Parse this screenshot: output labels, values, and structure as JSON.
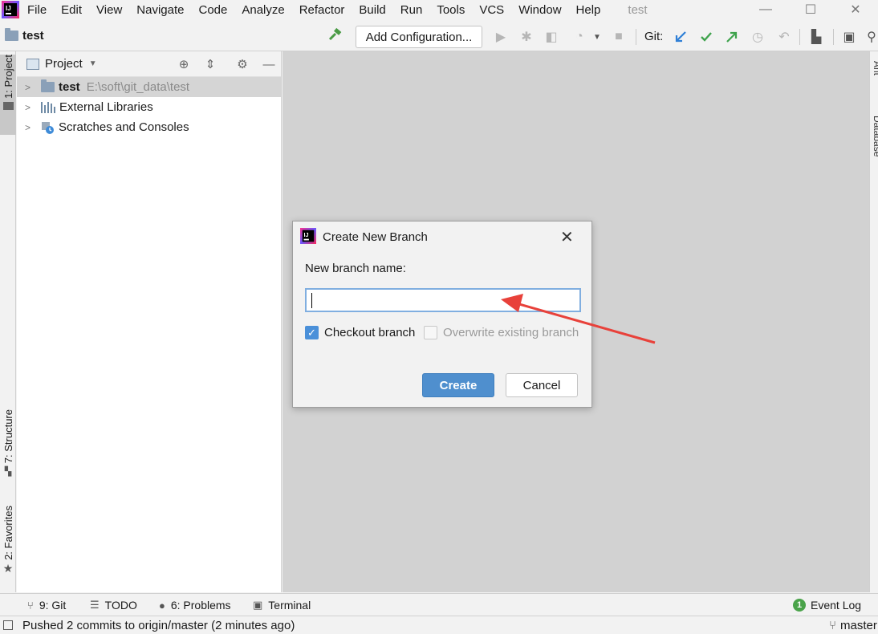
{
  "menu": {
    "items": [
      "File",
      "Edit",
      "View",
      "Navigate",
      "Code",
      "Analyze",
      "Refactor",
      "Build",
      "Run",
      "Tools",
      "VCS",
      "Window",
      "Help"
    ],
    "window_title": "test"
  },
  "navbar": {
    "project_name": "test",
    "add_configuration": "Add Configuration...",
    "git_label": "Git:"
  },
  "left_stripe": {
    "project_tab": "1: Project",
    "structure_tab": "7: Structure",
    "favorites_tab": "2: Favorites"
  },
  "right_stripe": {
    "ant_tab": "Ant",
    "database_tab": "Database"
  },
  "project_panel": {
    "title": "Project",
    "tree": [
      {
        "label": "test",
        "path": "E:\\soft\\git_data\\test"
      },
      {
        "label": "External Libraries",
        "path": ""
      },
      {
        "label": "Scratches and Consoles",
        "path": ""
      }
    ]
  },
  "dialog": {
    "title": "Create New Branch",
    "label": "New branch name:",
    "input_value": "",
    "checkout_label": "Checkout branch",
    "checkout_checked": true,
    "overwrite_label": "Overwrite existing branch",
    "overwrite_checked": false,
    "create_button": "Create",
    "cancel_button": "Cancel"
  },
  "bottom_tabs": {
    "git": "9: Git",
    "todo": "TODO",
    "problems": "6: Problems",
    "terminal": "Terminal",
    "event_log": "Event Log",
    "event_count": "1"
  },
  "status": {
    "message": "Pushed 2 commits to origin/master (2 minutes ago)",
    "branch": "master"
  },
  "colors": {
    "accent": "#4f8fce",
    "annotation_arrow": "#e8413a",
    "git_update": "#2f7fd6",
    "git_commit": "#3fa34d",
    "git_push": "#3fa34d"
  }
}
